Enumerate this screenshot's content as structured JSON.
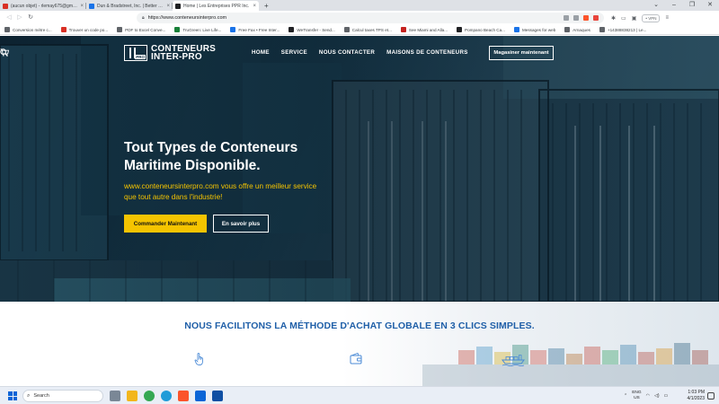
{
  "browser": {
    "tabs": [
      {
        "title": "(aucun objet) - rlemay675@gmail.com",
        "icon": "gmail-icon",
        "color": "#d93025",
        "active": false
      },
      {
        "title": "Dun & Bradstreet, Inc. | Better Business",
        "icon": "dnb-icon",
        "color": "#1a73e8",
        "active": false
      },
      {
        "title": "Home | Les Entreprises PPR Inc.",
        "icon": "site-icon",
        "color": "#202124",
        "active": true
      }
    ],
    "new_tab": "+",
    "url": "https://www.conteneursinterpro.com",
    "vpn_label": "• VPN",
    "bookmarks": [
      {
        "label": "Conversion métre c...",
        "color": "#5f6368"
      },
      {
        "label": "Trouver un code po...",
        "color": "#d93025"
      },
      {
        "label": "PDF to Excel Conve...",
        "color": "#5f6368"
      },
      {
        "label": "TruGreen: Live Life...",
        "color": "#188038"
      },
      {
        "label": "Free Fax • Free Inter...",
        "color": "#1a73e8"
      },
      {
        "label": "WeTransfer - Send...",
        "color": "#202124"
      },
      {
        "label": "Calcul taxes TPS et...",
        "color": "#5f6368"
      },
      {
        "label": "See Miami and Alla...",
        "color": "#c5221f"
      },
      {
        "label": "Pompano Beach Ca...",
        "color": "#202124"
      },
      {
        "label": "Messages for web",
        "color": "#1a73e8"
      },
      {
        "label": "Arnaques",
        "color": "#5f6368"
      },
      {
        "label": "+14388838213 | Le...",
        "color": "#5f6368"
      }
    ]
  },
  "site": {
    "logo_line1": "CONTENEURS",
    "logo_line2": "INTER-PRO",
    "logo_badge": "PRO",
    "nav": [
      "HOME",
      "SERVICE",
      "NOUS CONTACTER",
      "MAISONS DE CONTENEURS"
    ],
    "shop_button": "Magasiner maintenant",
    "headline_line1": "Tout Types de Conteneurs",
    "headline_line2": "Maritime Disponible.",
    "subline": "www.conteneursinterpro.com vous offre un meilleur service que tout autre dans l'industrie!",
    "cta_primary": "Commander Maintenant",
    "cta_secondary": "En savoir plus",
    "section_title": "NOUS FACILITONS LA MÉTHODE D'ACHAT GLOBALE EN 3 CLICS SIMPLES.",
    "steps": [
      {
        "icon": "hand-pointer-icon"
      },
      {
        "icon": "wallet-icon"
      },
      {
        "icon": "cargo-ship-icon"
      }
    ],
    "accent_yellow": "#f5c400",
    "accent_blue": "#1f5fa8"
  },
  "taskbar": {
    "search_placeholder": "Search",
    "lang_line1": "ENG",
    "lang_line2": "US",
    "time": "1:03 PM",
    "date": "4/1/2023"
  }
}
